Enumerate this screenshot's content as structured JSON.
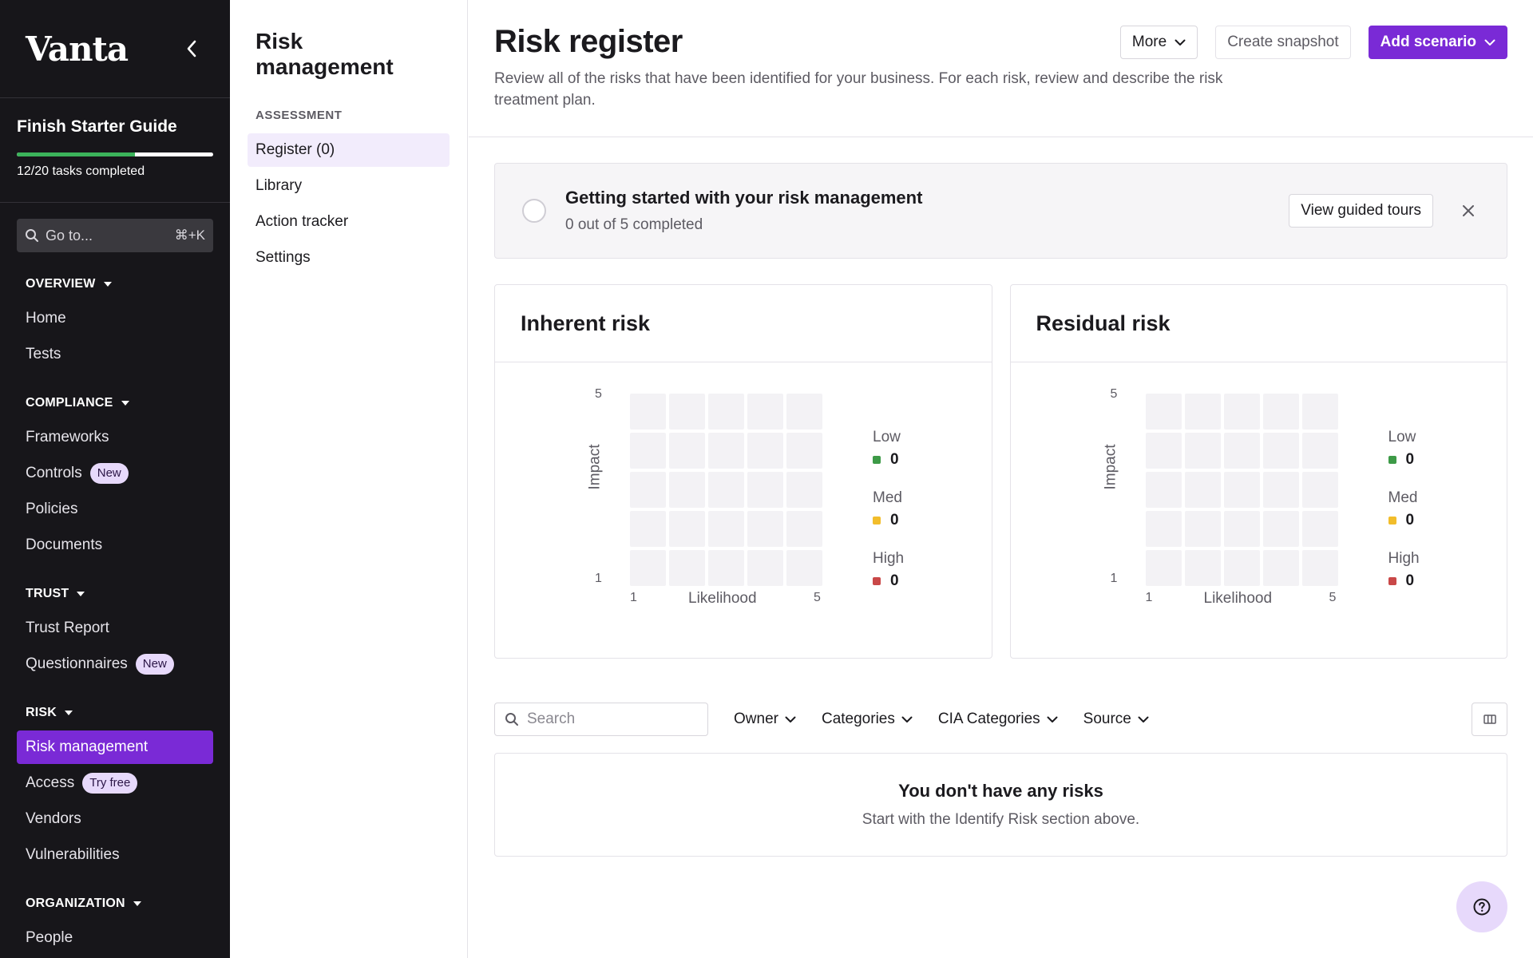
{
  "sidebar": {
    "logo": "Vanta",
    "guide": {
      "title": "Finish Starter Guide",
      "progress": 0.6,
      "tasks_text": "12/20 tasks completed"
    },
    "goto": {
      "label": "Go to...",
      "shortcut": "⌘+K"
    },
    "sections": {
      "overview": {
        "title": "OVERVIEW",
        "items": [
          "Home",
          "Tests"
        ]
      },
      "compliance": {
        "title": "COMPLIANCE",
        "frameworks": "Frameworks",
        "controls": "Controls",
        "controls_badge": "New",
        "policies": "Policies",
        "documents": "Documents"
      },
      "trust": {
        "title": "TRUST",
        "trust_report": "Trust Report",
        "questionnaires": "Questionnaires",
        "questionnaires_badge": "New"
      },
      "risk": {
        "title": "RISK",
        "risk_management": "Risk management",
        "access": "Access",
        "access_badge": "Try free",
        "vendors": "Vendors",
        "vulnerabilities": "Vulnerabilities"
      },
      "organization": {
        "title": "ORGANIZATION",
        "people": "People"
      }
    }
  },
  "subnav": {
    "title": "Risk management",
    "section_label": "ASSESSMENT",
    "items": [
      "Register (0)",
      "Library",
      "Action tracker",
      "Settings"
    ],
    "active_index": 0
  },
  "header": {
    "title": "Risk register",
    "description": "Review all of the risks that have been identified for your business. For each risk, review and describe the risk treatment plan.",
    "more_label": "More",
    "snapshot_label": "Create snapshot",
    "add_label": "Add scenario"
  },
  "banner": {
    "title": "Getting started with your risk management",
    "subtitle": "0 out of 5 completed",
    "button_label": "View guided tours"
  },
  "matrices": {
    "inherent": {
      "title": "Inherent risk",
      "y_max": "5",
      "y_min": "1",
      "y_label": "Impact",
      "x_min": "1",
      "x_max": "5",
      "x_label": "Likelihood",
      "low_label": "Low",
      "low_value": "0",
      "med_label": "Med",
      "med_value": "0",
      "high_label": "High",
      "high_value": "0"
    },
    "residual": {
      "title": "Residual risk",
      "y_max": "5",
      "y_min": "1",
      "y_label": "Impact",
      "x_min": "1",
      "x_max": "5",
      "x_label": "Likelihood",
      "low_label": "Low",
      "low_value": "0",
      "med_label": "Med",
      "med_value": "0",
      "high_label": "High",
      "high_value": "0"
    }
  },
  "colors": {
    "accent": "#7a2ad6",
    "low": "#3d9a47",
    "med": "#f2bd2b",
    "high": "#c94848"
  },
  "filters": {
    "search_placeholder": "Search",
    "owner": "Owner",
    "categories": "Categories",
    "cia_categories": "CIA Categories",
    "source": "Source"
  },
  "empty_state": {
    "title": "You don't have any risks",
    "subtitle": "Start with the Identify Risk section above."
  }
}
